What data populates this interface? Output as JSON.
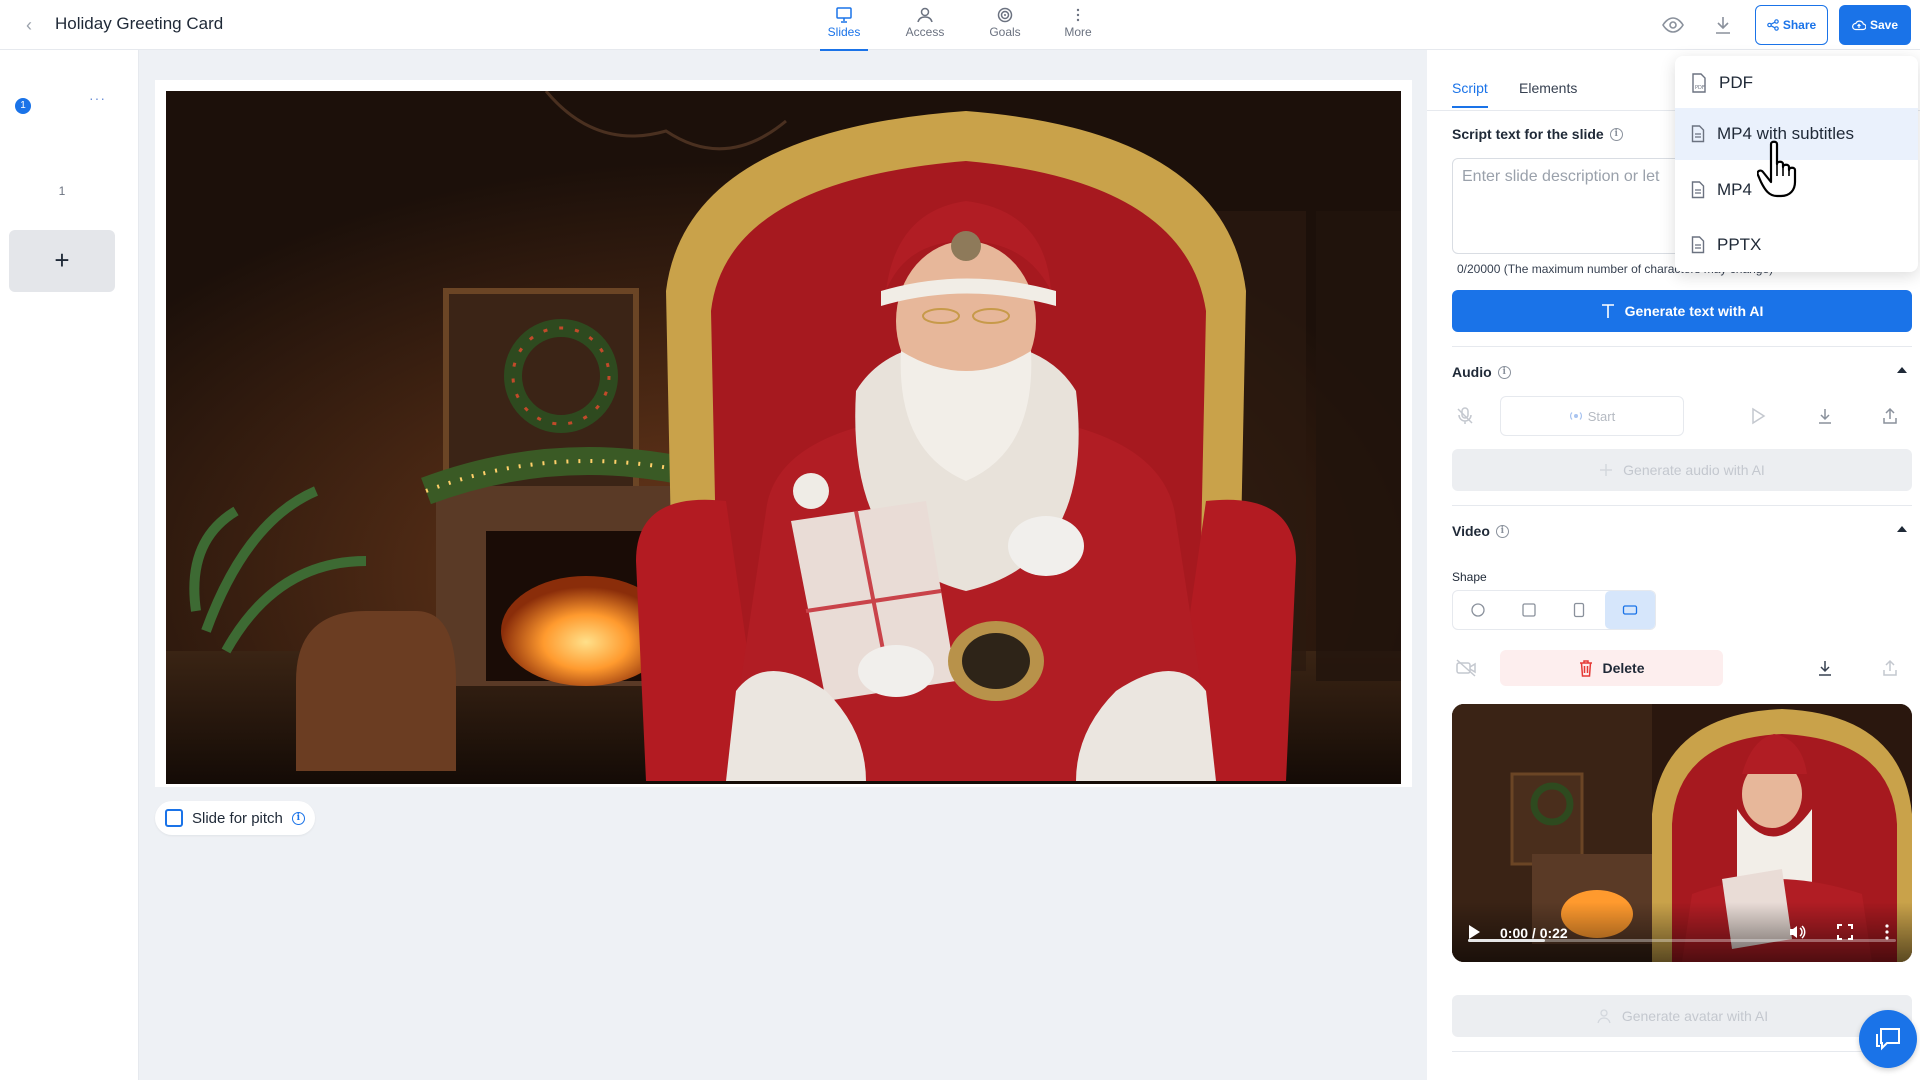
{
  "header": {
    "title": "Holiday Greeting Card",
    "tabs": [
      {
        "label": "Slides",
        "icon": "presentation-icon",
        "active": true
      },
      {
        "label": "Access",
        "icon": "user-icon",
        "active": false
      },
      {
        "label": "Goals",
        "icon": "target-icon",
        "active": false
      },
      {
        "label": "More",
        "icon": "kebab-icon",
        "active": false
      }
    ],
    "share_label": "Share",
    "save_label": "Save"
  },
  "sidebar": {
    "slides": [
      {
        "badge": "1",
        "number": "1",
        "more": "···"
      }
    ],
    "add_label": "+"
  },
  "canvas": {
    "pitch_label": "Slide for pitch"
  },
  "panel": {
    "tabs": [
      {
        "label": "Script",
        "active": true
      },
      {
        "label": "Elements",
        "active": false
      }
    ],
    "script": {
      "label": "Script text for the slide",
      "placeholder": "Enter slide description or let",
      "char_count": "0/20000 (The maximum number of characters may change)",
      "generate_label": "Generate text with AI"
    },
    "audio": {
      "label": "Audio",
      "start_label": "Start",
      "generate_label": "Generate audio with AI"
    },
    "video": {
      "label": "Video",
      "shape_label": "Shape",
      "delete_label": "Delete",
      "time": "0:00 / 0:22",
      "progress": 0.18,
      "generate_avatar_label": "Generate avatar with AI"
    }
  },
  "download_menu": {
    "items": [
      {
        "label": "PDF",
        "icon": "pdf-file-icon"
      },
      {
        "label": "MP4 with subtitles",
        "icon": "file-icon",
        "hovered": true
      },
      {
        "label": "MP4",
        "icon": "file-icon"
      },
      {
        "label": "PPTX",
        "icon": "file-icon"
      }
    ]
  },
  "colors": {
    "accent": "#1a73e8",
    "background": "#eef1f5",
    "delete_bg": "#fdeeee",
    "delete_icon": "#e53935"
  }
}
